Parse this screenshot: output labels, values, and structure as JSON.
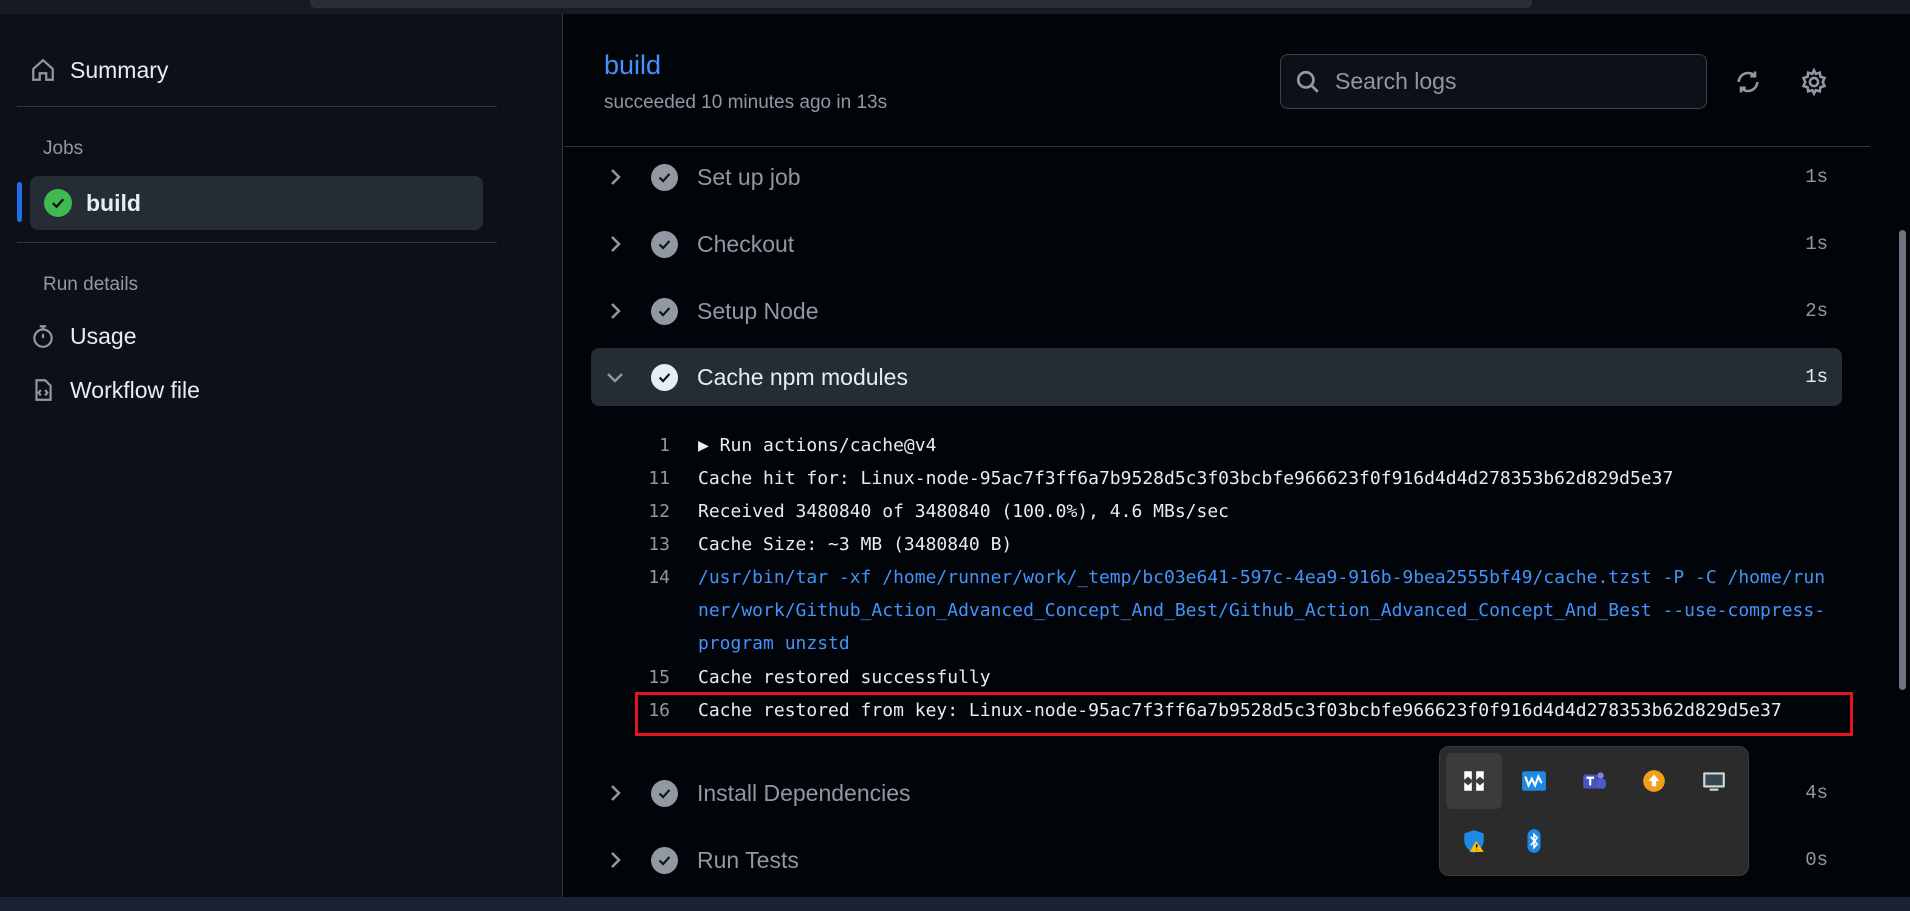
{
  "sidebar": {
    "summary_label": "Summary",
    "jobs_heading": "Jobs",
    "active_job": "build",
    "run_details_heading": "Run details",
    "usage_label": "Usage",
    "workflow_file_label": "Workflow file"
  },
  "header": {
    "job_title": "build",
    "status": "succeeded 10 minutes ago in 13s",
    "search_placeholder": "Search logs"
  },
  "steps": [
    {
      "name": "Set up job",
      "duration": "1s"
    },
    {
      "name": "Checkout",
      "duration": "1s"
    },
    {
      "name": "Setup Node",
      "duration": "2s"
    },
    {
      "name": "Cache npm modules",
      "duration": "1s"
    },
    {
      "name": "Install Dependencies",
      "duration": "4s"
    },
    {
      "name": "Run Tests",
      "duration": "0s"
    }
  ],
  "log": [
    {
      "num": "1",
      "text": "▶ Run actions/cache@v4"
    },
    {
      "num": "11",
      "text": "Cache hit for: Linux-node-95ac7f3ff6a7b9528d5c3f03bcbfe966623f0f916d4d4d278353b62d829d5e37"
    },
    {
      "num": "12",
      "text": "Received 3480840 of 3480840 (100.0%), 4.6 MBs/sec"
    },
    {
      "num": "13",
      "text": "Cache Size: ~3 MB (3480840 B)"
    },
    {
      "num": "14",
      "text": "/usr/bin/tar -xf /home/runner/work/_temp/bc03e641-597c-4ea9-916b-9bea2555bf49/cache.tzst -P -C /home/runner/work/Github_Action_Advanced_Concept_And_Best/Github_Action_Advanced_Concept_And_Best --use-compress-program unzstd"
    },
    {
      "num": "15",
      "text": "Cache restored successfully"
    },
    {
      "num": "16",
      "text": "Cache restored from key: Linux-node-95ac7f3ff6a7b9528d5c3f03bcbfe966623f0f916d4d4d278353b62d829d5e37"
    }
  ],
  "colors": {
    "accent": "#4493f8",
    "success": "#3fb950",
    "highlight": "#e5141e"
  },
  "tray_icons": [
    "app-grid-icon",
    "waveform-app-icon",
    "teams-icon",
    "update-icon",
    "display-icon",
    "security-warning-icon",
    "bluetooth-icon"
  ]
}
